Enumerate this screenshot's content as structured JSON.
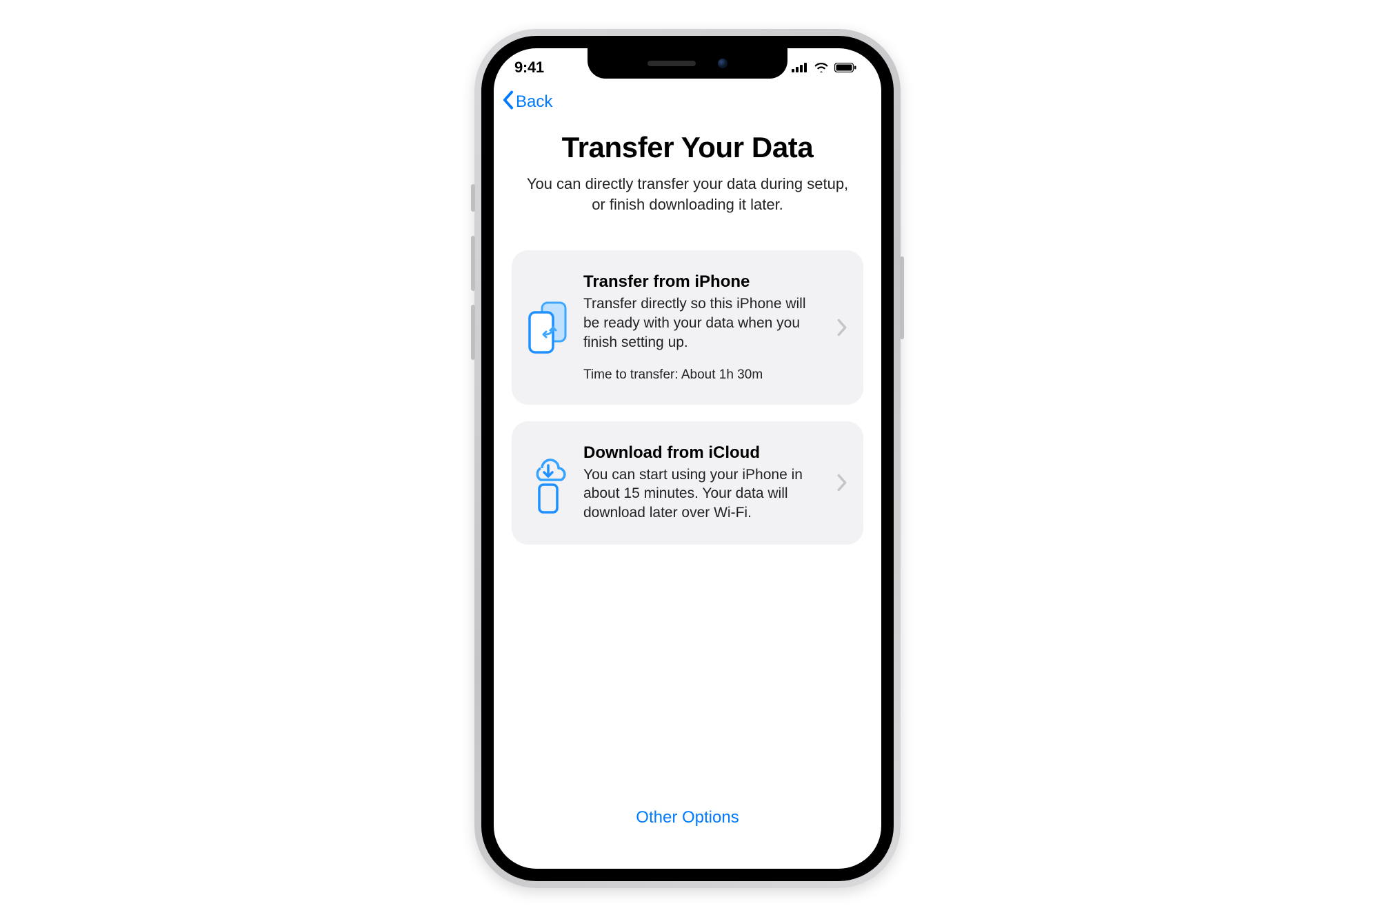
{
  "statusBar": {
    "time": "9:41"
  },
  "nav": {
    "backLabel": "Back"
  },
  "hero": {
    "title": "Transfer Your Data",
    "subtitle": "You can directly transfer your data during setup, or finish downloading it later."
  },
  "options": {
    "transferFromIphone": {
      "title": "Transfer from iPhone",
      "desc": "Transfer directly so this iPhone will be ready with your data when you finish setting up.",
      "meta": "Time to transfer: About 1h 30m"
    },
    "downloadFromIcloud": {
      "title": "Download from iCloud",
      "desc": "You can start using your iPhone in about 15 minutes. Your data will download later over Wi-Fi."
    }
  },
  "footer": {
    "otherOptions": "Other Options"
  },
  "colors": {
    "accent": "#007aff",
    "cardBg": "#f2f2f5",
    "chevron": "#c5c5c9"
  }
}
